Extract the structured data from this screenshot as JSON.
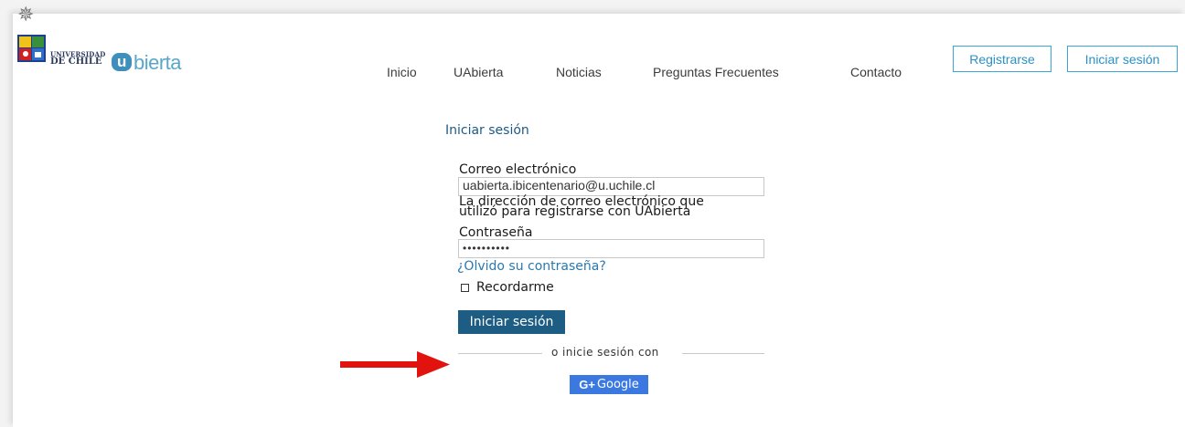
{
  "header": {
    "university_logo": {
      "line1": "UNIVERSIDAD",
      "line2": "DE CHILE"
    },
    "brand_logo": {
      "text": "bierta",
      "u": "u"
    }
  },
  "nav": {
    "items": [
      "Inicio",
      "UAbierta",
      "Noticias",
      "Preguntas Frecuentes",
      "Contacto"
    ],
    "register_label": "Registrarse",
    "login_label": "Iniciar sesión"
  },
  "login_form": {
    "title": "Iniciar sesión",
    "email_label": "Correo electrónico",
    "email_value": "uabierta.ibicentenario@u.uchile.cl",
    "email_hint_line1": "La dirección de correo electrónico que",
    "email_hint_line2": "utilizó para registrarse con UAbierta",
    "password_label": "Contraseña",
    "password_value": "••••••••••",
    "forgot_link": "¿Olvido su contraseña?",
    "remember_label": "Recordarme",
    "submit_label": "Iniciar sesión",
    "divider_text": "o inicie sesión con",
    "google_label": "Google",
    "google_prefix": "G+"
  },
  "colors": {
    "nav_button": "#3aa5d6",
    "primary": "#1d5c83",
    "google": "#3b79e0",
    "annotation_arrow": "#e2120e"
  },
  "icons": [
    "crest-icon",
    "checkbox-icon",
    "arrow-annotation-icon"
  ]
}
